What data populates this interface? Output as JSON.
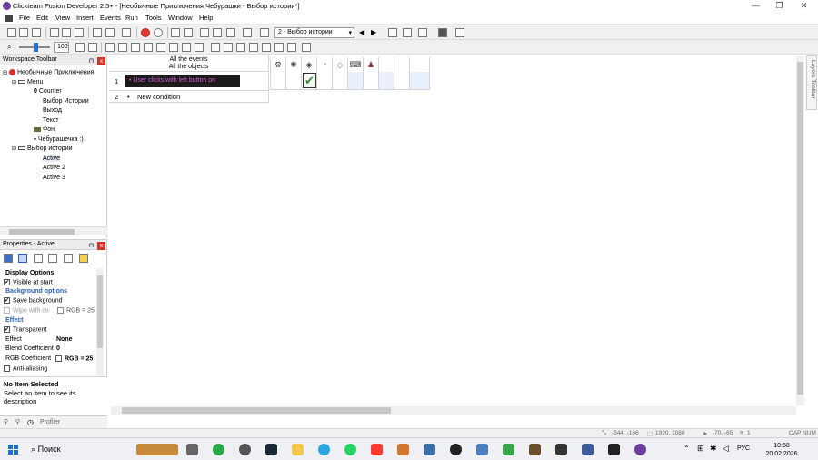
{
  "window": {
    "title": "Clickteam Fusion Developer 2.5+ - [Необычные Приключения Чебурашки - Выбор истории*]",
    "minimize": "—",
    "restore": "❐",
    "close": "✕"
  },
  "menu": [
    "File",
    "Edit",
    "View",
    "Insert",
    "Events",
    "Run",
    "Tools",
    "Window",
    "Help"
  ],
  "toolbar": {
    "frame_select": "2 - Выбор истории",
    "zoom": "100"
  },
  "workspace": {
    "title": "Workspace Toolbar",
    "pin": "⊓",
    "close": "x",
    "tree": [
      {
        "label": "Необычные Приключения",
        "level": 0
      },
      {
        "label": "Menu",
        "level": 1
      },
      {
        "label": "Counter",
        "level": 2
      },
      {
        "label": "Выбор Истории",
        "level": 2
      },
      {
        "label": "Выход",
        "level": 2
      },
      {
        "label": "Текст",
        "level": 2
      },
      {
        "label": "Фон",
        "level": 2
      },
      {
        "label": "Чебурашечка :)",
        "level": 2
      },
      {
        "label": "Выбор истории",
        "level": 1
      },
      {
        "label": "Active",
        "level": 2
      },
      {
        "label": "Active 2",
        "level": 2
      },
      {
        "label": "Active 3",
        "level": 2
      }
    ]
  },
  "events": {
    "header_line1": "All the events",
    "header_line2": "All the objects",
    "rows": [
      {
        "num": "1",
        "condition": "User clicks with left button on",
        "bullet": "•"
      },
      {
        "num": "2",
        "condition": "New condition",
        "bullet": "•"
      }
    ],
    "check": "✔"
  },
  "layers_toolbar": "Layers Toolbar",
  "properties": {
    "title": "Properties - Active",
    "rows": [
      {
        "type": "header",
        "label": "Display Options"
      },
      {
        "type": "check",
        "label": "Visible at start",
        "checked": true
      },
      {
        "type": "check",
        "label": "Save background",
        "checked": true
      },
      {
        "type": "section",
        "label": "Background options"
      },
      {
        "type": "checkval",
        "label": "Wipe with co",
        "value": "RGB = 25",
        "checked": false
      },
      {
        "type": "section",
        "label": "Effect"
      },
      {
        "type": "check",
        "label": "Transparent",
        "checked": true
      },
      {
        "type": "kv",
        "label": "Effect",
        "value": "None"
      },
      {
        "type": "kv",
        "label": "Blend Coefficient",
        "value": "0"
      },
      {
        "type": "kv2",
        "label": "RGB Coefficient",
        "value": "RGB = 25"
      },
      {
        "type": "check",
        "label": "Anti-aliasing",
        "checked": false
      }
    ],
    "desc_title": "No Item Selected",
    "desc_text": "Select an item to see its description"
  },
  "bottom_tabs": {
    "profiler": "Profiler"
  },
  "status": {
    "coords1": "-344, -166",
    "size": "1920, 1080",
    "coords2": "-70, -65",
    "layer": "1",
    "caps": "CAP NUM"
  },
  "taskbar": {
    "search": "Поиск",
    "lang": "РУС",
    "time": "10:58",
    "date": "20.02.2026"
  },
  "colors": {
    "accent": "#2b5fb4",
    "condition_bg": "#1a1a1a",
    "condition_fg": "#d05cd0",
    "close_red": "#d9302c"
  }
}
